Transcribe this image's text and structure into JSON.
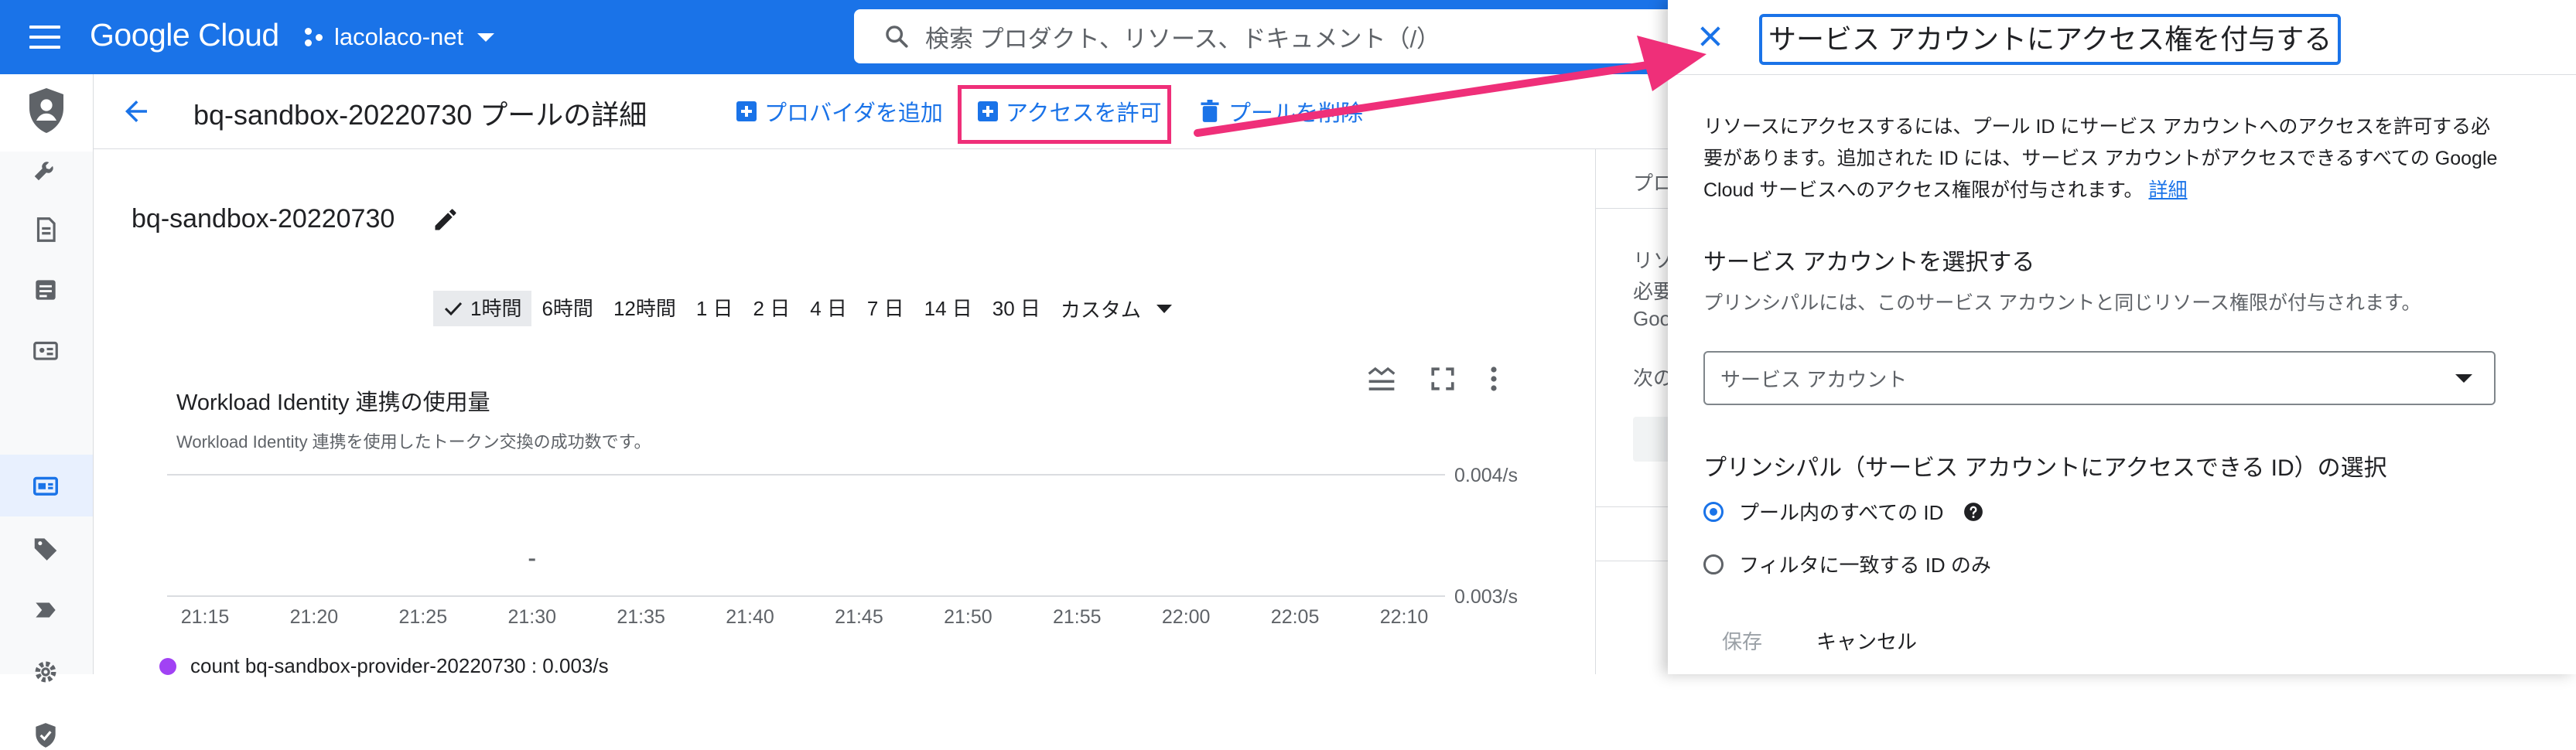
{
  "topbar": {
    "logo": "Google Cloud",
    "project": "lacolaco-net",
    "search_placeholder": "検索 プロダクト、リソース、ドキュメント（/）"
  },
  "header": {
    "title": "bq-sandbox-20220730 プールの詳細",
    "add_provider": "プロバイダを追加",
    "grant_access": "アクセスを許可",
    "delete_pool": "プールを削除"
  },
  "main": {
    "pool_name": "bq-sandbox-20220730",
    "time_ranges": [
      "1時間",
      "6時間",
      "12時間",
      "1 日",
      "2 日",
      "4 日",
      "7 日",
      "14 日",
      "30 日"
    ],
    "custom_label": "カスタム",
    "chart_title": "Workload Identity 連携の使用量",
    "chart_subtitle": "Workload Identity 連携を使用したトークン交換の成功数です。"
  },
  "chart_data": {
    "type": "line",
    "title": "Workload Identity 連携の使用量",
    "subtitle": "Workload Identity 連携を使用したトークン交換の成功数です。",
    "x_ticks": [
      "21:15",
      "21:20",
      "21:25",
      "21:30",
      "21:35",
      "21:40",
      "21:45",
      "21:50",
      "21:55",
      "22:00",
      "22:05",
      "22:10"
    ],
    "y_ticks": [
      "0.004/s",
      "0.003/s"
    ],
    "ylim": [
      0.003,
      0.004
    ],
    "grid": true,
    "series": [
      {
        "name": "count bq-sandbox-provider-20220730 : 0.003/s",
        "color": "#a142f4",
        "points": [
          {
            "x": "21:30",
            "y": 0.0033
          }
        ]
      }
    ]
  },
  "side_panel": {
    "tab": "プロ",
    "lines": [
      "リソ",
      "必要",
      "Goo",
      "次の"
    ]
  },
  "drawer": {
    "title": "サービス アカウントにアクセス権を付与する",
    "description": "リソースにアクセスするには、プール ID にサービス アカウントへのアクセスを許可する必要があります。追加された ID には、サービス アカウントがアクセスできるすべての Google Cloud サービスへのアクセス権限が付与されます。",
    "detail_link": "詳細",
    "select_heading": "サービス アカウントを選択する",
    "select_hint": "プリンシパルには、このサービス アカウントと同じリソース権限が付与されます。",
    "select_placeholder": "サービス アカウント",
    "principal_heading": "プリンシパル（サービス アカウントにアクセスできる ID）の選択",
    "radio_all": "プール内のすべての ID",
    "radio_filter": "フィルタに一致する ID のみ",
    "save": "保存",
    "cancel": "キャンセル"
  },
  "colors": {
    "primary": "#1a73e8",
    "highlight": "#ef2f79",
    "series": "#a142f4"
  }
}
